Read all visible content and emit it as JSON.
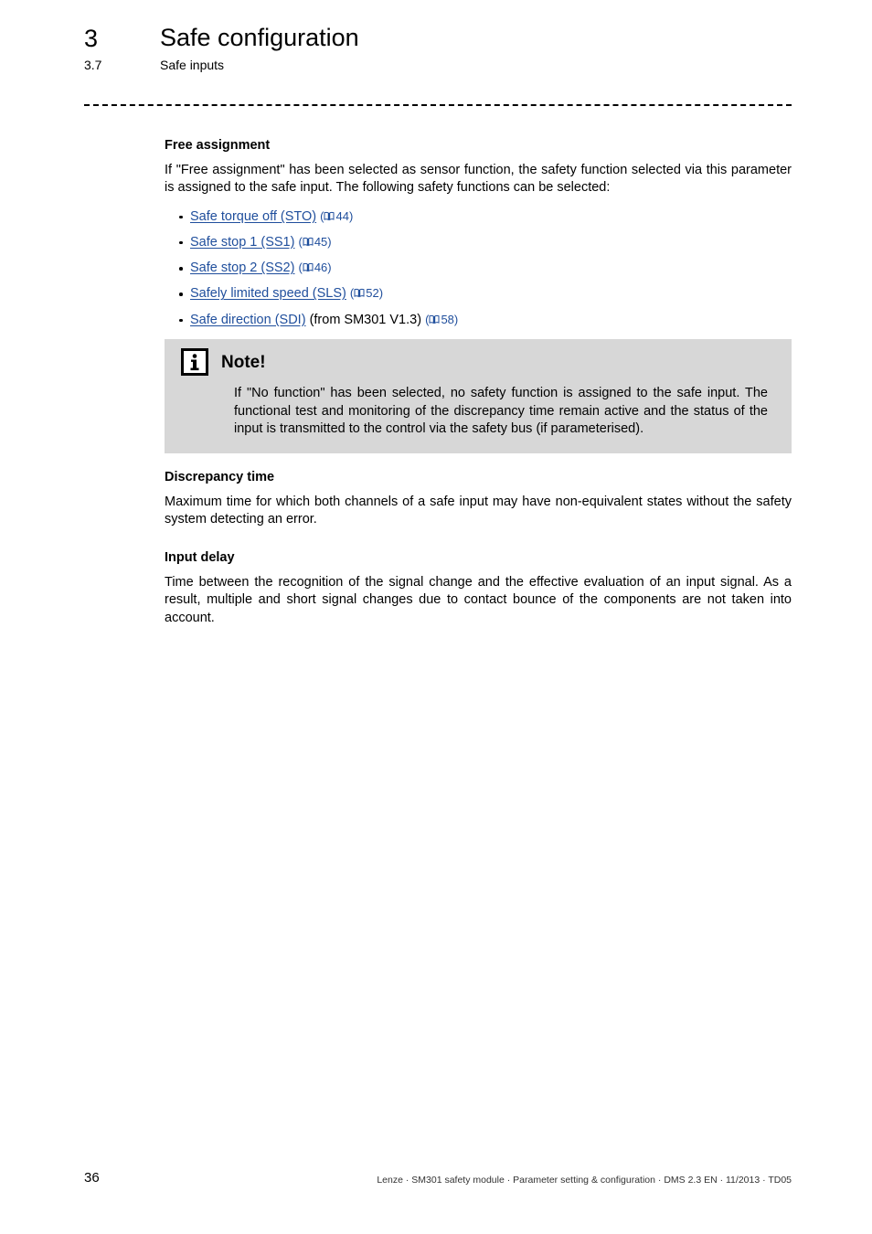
{
  "header": {
    "chapter_number": "3",
    "chapter_title": "Safe configuration",
    "section_number": "3.7",
    "section_title": "Safe inputs"
  },
  "main": {
    "free_assignment": {
      "heading": "Free assignment",
      "paragraph": "If \"Free assignment\" has been selected as sensor function, the safety function selected via this parameter is assigned to the safe input. The following safety functions can be selected:",
      "links": [
        {
          "label": "Safe torque off (STO)",
          "suffix": "",
          "page": "44",
          "icon": "book-icon"
        },
        {
          "label": "Safe stop 1 (SS1)",
          "suffix": "",
          "page": "45",
          "icon": "book-icon"
        },
        {
          "label": "Safe stop 2 (SS2)",
          "suffix": "",
          "page": "46",
          "icon": "book-icon"
        },
        {
          "label": "Safely limited speed (SLS)",
          "suffix": "",
          "page": "52",
          "icon": "book-icon"
        },
        {
          "label": "Safe direction (SDI)",
          "suffix": "(from SM301 V1.3)",
          "page": "58",
          "icon": "book-icon"
        }
      ]
    },
    "note": {
      "icon": "info-icon",
      "title": "Note!",
      "body": "If \"No function\" has been selected, no safety function is assigned to the safe input. The functional test and monitoring of the discrepancy time remain active and the status of the input is transmitted to the control via the safety bus (if parameterised)."
    },
    "discrepancy_time": {
      "heading": "Discrepancy time",
      "paragraph": "Maximum time for which both channels of a safe input may have non-equivalent states without the safety system detecting an error."
    },
    "input_delay": {
      "heading": "Input delay",
      "paragraph": "Time between the recognition of the signal change and the effective evaluation of an input signal. As a result, multiple and short signal changes due to contact bounce of the components are not taken into account."
    }
  },
  "footer": {
    "page_number": "36",
    "meta": "Lenze · SM301 safety module · Parameter setting & configuration · DMS 2.3 EN · 11/2013 · TD05"
  },
  "colors": {
    "link": "#1f4e9c",
    "note_background": "#d7d7d7",
    "text": "#000000"
  }
}
